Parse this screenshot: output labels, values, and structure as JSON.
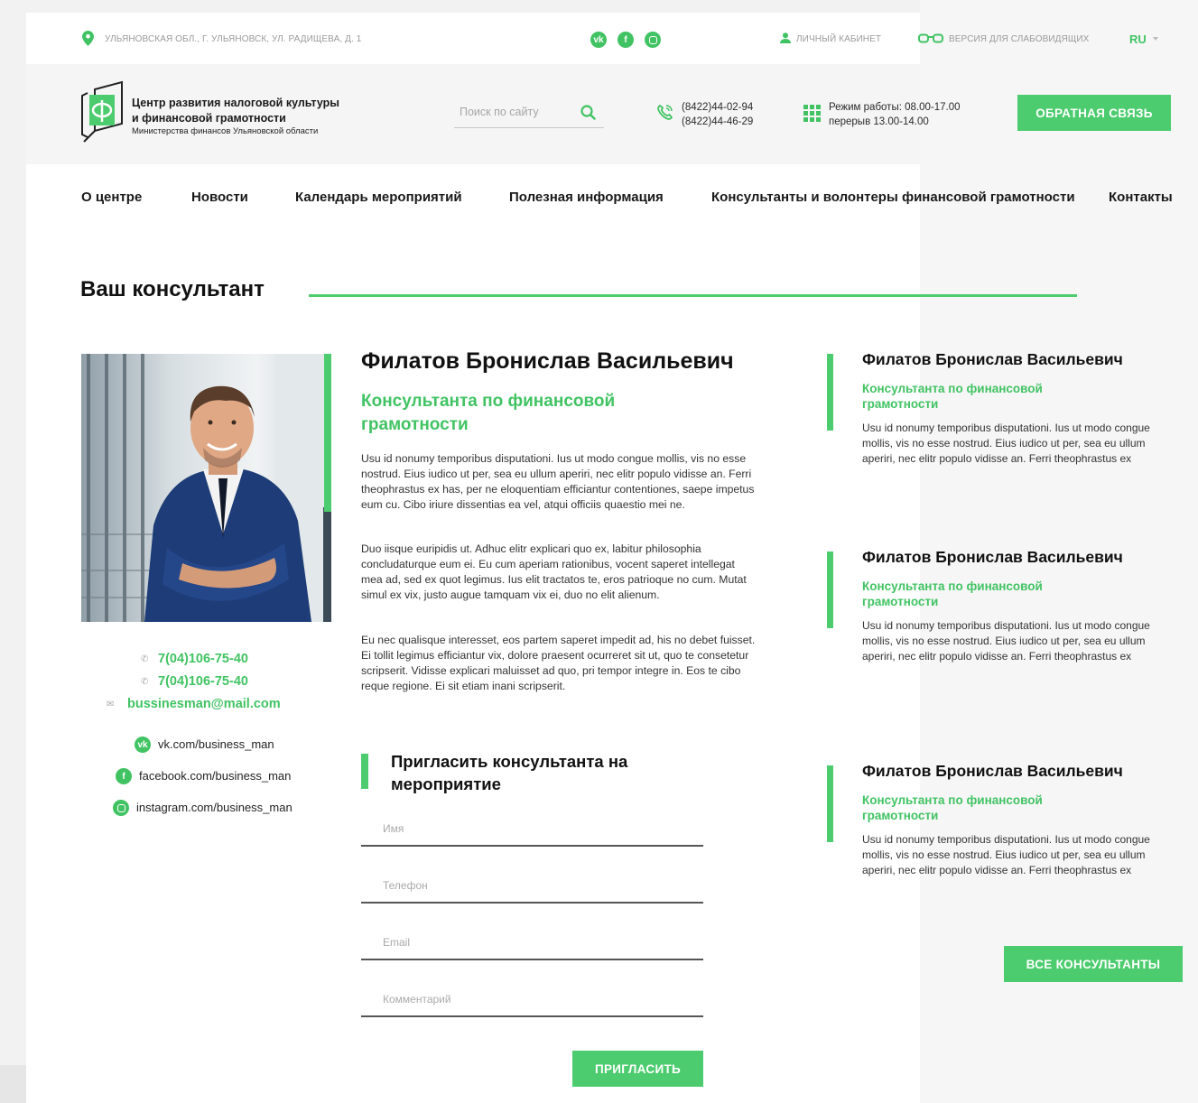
{
  "colors": {
    "accent": "#41c363",
    "button": "#4ccc6e"
  },
  "topbar": {
    "address": "УЛЬЯНОВСКАЯ ОБЛ., Г. УЛЬЯНОВСК, УЛ. РАДИЩЕВА, Д. 1",
    "social_icons": [
      "vk-icon",
      "facebook-icon",
      "instagram-icon"
    ],
    "account_label": "ЛИЧНЫЙ КАБИНЕТ",
    "accessibility_label": "ВЕРСИЯ ДЛЯ СЛАБОВИДЯЩИХ",
    "language": "RU"
  },
  "header": {
    "logo_line1": "Центр развития налоговой культуры",
    "logo_line2": "и финансовой грамотности",
    "logo_line3": "Министерства финансов Ульяновской области",
    "search_placeholder": "Поиск по сайту",
    "phone1": "(8422)44-02-94",
    "phone2": "(8422)44-46-29",
    "hours_line1": "Режим работы: 08.00-17.00",
    "hours_line2": "перерыв 13.00-14.00",
    "feedback_button": "ОБРАТНАЯ СВЯЗЬ"
  },
  "nav": {
    "items": [
      "О центре",
      "Новости",
      "Календарь мероприятий",
      "Полезная информация",
      "Консультанты и волонтеры финансовой грамотности",
      "Контакты"
    ]
  },
  "page": {
    "title": "Ваш консультант"
  },
  "consultant": {
    "name": "Филатов Бронислав Васильевич",
    "role": "Консультанта по финансовой грамотности",
    "paragraphs": [
      "Usu id nonumy temporibus disputationi. Ius ut modo congue mollis, vis no esse nostrud. Eius iudico ut per, sea eu ullum aperiri, nec elitr populo vidisse an. Ferri theophrastus ex has, per ne eloquentiam efficiantur contentiones, saepe impetus eum cu. Cibo iriure dissentias ea vel, atqui officiis quaestio mei ne.",
      "Duo iisque euripidis ut. Adhuc elitr explicari quo ex, labitur philosophia concludaturque eum ei. Eu cum aperiam rationibus, vocent saperet intellegat mea ad, sed ex quot legimus. Ius elit tractatos te, eros patrioque no cum. Mutat simul ex vix, justo augue tamquam vix ei, duo no elit alienum.",
      "Eu nec qualisque interesset, eos partem saperet impedit ad, his no debet fuisset. Ei tollit legimus efficiantur vix, dolore praesent ocurreret sit ut, quo te consetetur scripserit. Vidisse explicari maluisset ad quo, pri tempor integre in. Eos te cibo reque regione. Ei sit etiam inani scripserit."
    ],
    "phone1": "7(04)106-75-40",
    "phone2": "7(04)106-75-40",
    "email": "bussinesman@mail.com",
    "vk": "vk.com/business_man",
    "facebook": "facebook.com/business_man",
    "instagram": "instagram.com/business_man"
  },
  "invite_form": {
    "title_line1": "Пригласить консультанта на",
    "title_line2": "мероприятие",
    "name_placeholder": "Имя",
    "phone_placeholder": "Телефон",
    "email_placeholder": "Email",
    "comment_placeholder": "Комментарий",
    "submit": "ПРИГЛАСИТЬ"
  },
  "other_consultants": [
    {
      "name": "Филатов Бронислав Васильевич",
      "role_line1": "Консультанта по финансовой",
      "role_line2": "грамотности",
      "bio": "Usu id nonumy temporibus disputationi. Ius ut modo congue mollis, vis no esse nostrud. Eius iudico ut per, sea eu ullum aperiri, nec elitr populo vidisse an. Ferri theophrastus ex"
    },
    {
      "name": "Филатов Бронислав Васильевич",
      "role_line1": "Консультанта по финансовой",
      "role_line2": "грамотности",
      "bio": "Usu id nonumy temporibus disputationi. Ius ut modo congue mollis, vis no esse nostrud. Eius iudico ut per, sea eu ullum aperiri, nec elitr populo vidisse an. Ferri theophrastus ex"
    },
    {
      "name": "Филатов Бронислав Васильевич",
      "role_line1": "Консультанта по финансовой",
      "role_line2": "грамотности",
      "bio": "Usu id nonumy temporibus disputationi. Ius ut modo congue mollis, vis no esse nostrud. Eius iudico ut per, sea eu ullum aperiri, nec elitr populo vidisse an. Ferri theophrastus ex"
    }
  ],
  "all_consultants_button": "ВСЕ КОНСУЛЬТАНТЫ"
}
